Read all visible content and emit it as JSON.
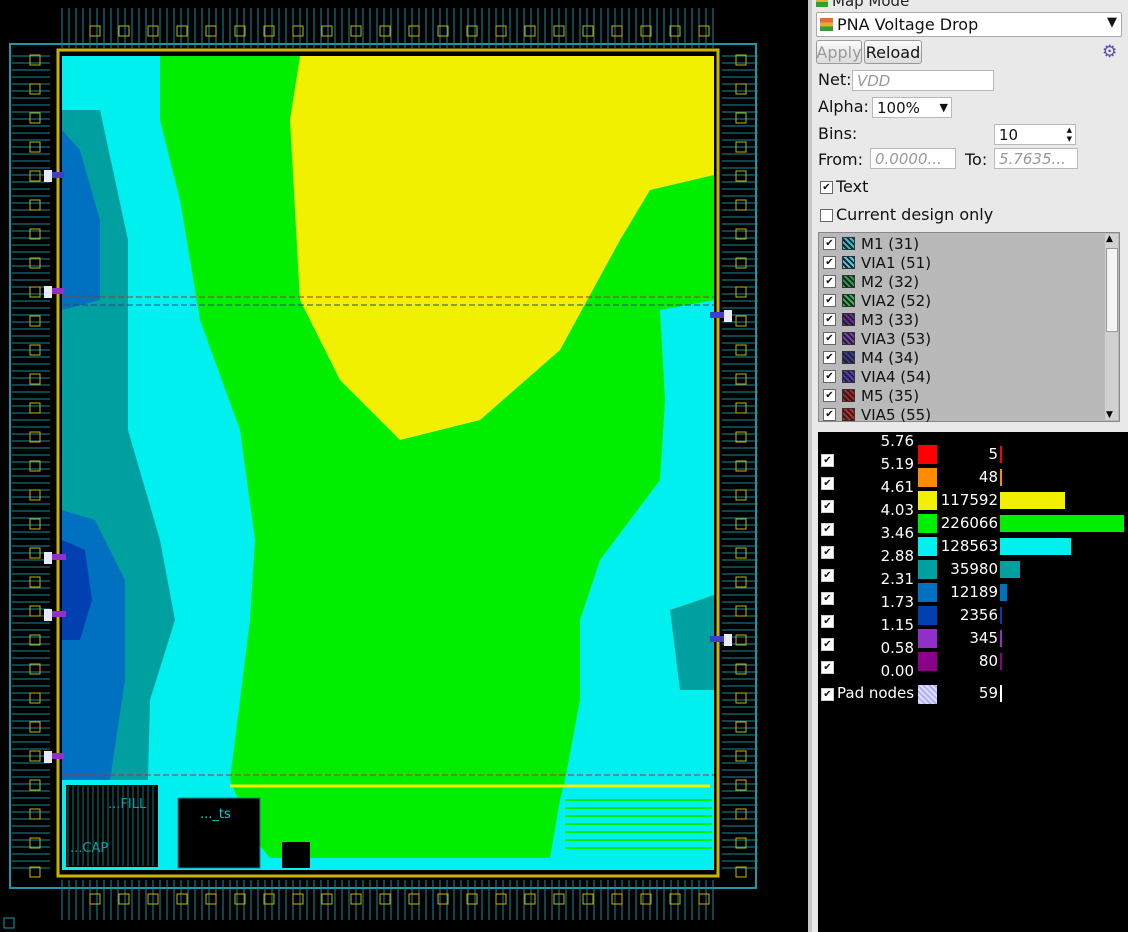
{
  "panel": {
    "title": "Map Mode",
    "map_selected": "PNA Voltage Drop",
    "apply_label": "Apply",
    "reload_label": "Reload",
    "net_label": "Net:",
    "net_value": "VDD",
    "alpha_label": "Alpha:",
    "alpha_value": "100%",
    "bins_label": "Bins:",
    "bins_value": "10",
    "from_label": "From:",
    "from_value": "0.0000...",
    "to_label": "To:",
    "to_value": "5.7635...",
    "text_label": "Text",
    "text_checked": true,
    "current_design_label": "Current design only",
    "current_design_checked": false
  },
  "layers": [
    {
      "name": "M1 (31)",
      "color": "#27c8d8"
    },
    {
      "name": "VIA1 (51)",
      "color": "#4ad0e8"
    },
    {
      "name": "M2 (32)",
      "color": "#2aa04a"
    },
    {
      "name": "VIA2 (52)",
      "color": "#33b852"
    },
    {
      "name": "M3 (33)",
      "color": "#6a2aa8"
    },
    {
      "name": "VIA3 (53)",
      "color": "#7a3ac0"
    },
    {
      "name": "M4 (34)",
      "color": "#3a3a9a"
    },
    {
      "name": "VIA4 (54)",
      "color": "#5a3ac8"
    },
    {
      "name": "M5 (35)",
      "color": "#b82020"
    },
    {
      "name": "VIA5 (55)",
      "color": "#d02828"
    }
  ],
  "legend": {
    "top_value": "5.76",
    "bins": [
      {
        "value": "5.19",
        "color": "#ff0000",
        "count": "5",
        "n": 5
      },
      {
        "value": "4.61",
        "color": "#ff8c00",
        "count": "48",
        "n": 48
      },
      {
        "value": "4.03",
        "color": "#f0f000",
        "count": "117592",
        "n": 117592
      },
      {
        "value": "3.46",
        "color": "#00ee00",
        "count": "226066",
        "n": 226066
      },
      {
        "value": "2.88",
        "color": "#00f0f0",
        "count": "128563",
        "n": 128563
      },
      {
        "value": "2.31",
        "color": "#00a0a0",
        "count": "35980",
        "n": 35980
      },
      {
        "value": "1.73",
        "color": "#0070c0",
        "count": "12189",
        "n": 12189
      },
      {
        "value": "1.15",
        "color": "#0040b0",
        "count": "2356",
        "n": 2356
      },
      {
        "value": "0.58",
        "color": "#9030c8",
        "count": "345",
        "n": 345
      },
      {
        "value": "0.00",
        "color": "#8a008a",
        "count": "80",
        "n": 80
      }
    ],
    "pad_label": "Pad nodes",
    "pad_count": "59"
  },
  "layout": {
    "label_full": "...FILL",
    "label_ts": "..._ts",
    "label_cap": "...CAP"
  }
}
